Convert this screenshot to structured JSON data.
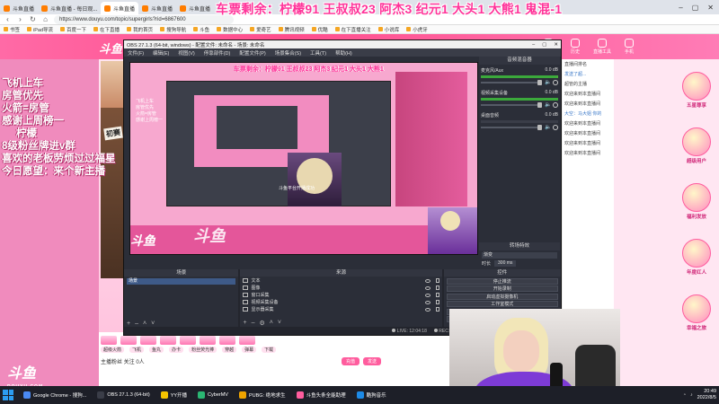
{
  "browser": {
    "tabs": [
      {
        "label": "斗鱼直播",
        "active": false,
        "fav": "orange"
      },
      {
        "label": "斗鱼直播 - 每日观...",
        "active": false,
        "fav": "orange"
      },
      {
        "label": "斗鱼直播",
        "active": true,
        "fav": "orange"
      },
      {
        "label": "斗鱼直播",
        "active": false,
        "fav": "orange"
      },
      {
        "label": "斗鱼直播",
        "active": false,
        "fav": "orange"
      }
    ],
    "url": "https://www.douyu.com/topic/supergirls?rid=6867600",
    "bookmarks": [
      "书签",
      "iPad导流",
      "百度一下",
      "在下直播",
      "我的首页",
      "搜狗导航",
      "斗鱼",
      "数据中心",
      "爱奇艺",
      "腾讯视频",
      "优酷",
      "在下直播关注",
      "小说库",
      "小虎牙"
    ]
  },
  "ticker": "车票剩余：柠檬91 王叔叔23 阿杰3 纪元1 大头1 大熊1 鬼混-1",
  "overlay_lines": [
    "飞机上车",
    "房管优先",
    "火箭=房管",
    "感谢上周榜一",
    "柠檬",
    "8级粉丝牌进v群",
    "喜欢的老板劳烦过过福星",
    "今日愿望：来个新主播"
  ],
  "douyu_logo": "斗鱼",
  "douyu_domain": "DOUYU.COM",
  "header_icons": [
    "关注",
    "历史",
    "直播工具",
    "手机"
  ],
  "obs": {
    "title": "OBS 27.1.3 (64-bit, windows) - 配置文件: 未命名 - 场景: 未命名",
    "menu": [
      "文件(F)",
      "编辑(E)",
      "视图(V)",
      "停靠部件(D)",
      "配置文件(P)",
      "场景集合(S)",
      "工具(T)",
      "帮助(H)"
    ],
    "preview_ticker": "车票剩余：柠檬91 王叔叔23 阿杰3 纪元1 大头1 大熊1",
    "preview_lines": [
      "飞机上车",
      "房管优先",
      "火箭=房管",
      "感谢上周榜一"
    ],
    "preview_notice": "斗鱼平台开播成功",
    "preview_watermark": "斗鱼",
    "mixer_title": "音频混音器",
    "channels": [
      {
        "name": "麦克风/Aux",
        "db": "0.0 dB",
        "level": 0.72,
        "active": true
      },
      {
        "name": "视频采集设备",
        "db": "0.0 dB",
        "level": 0.58,
        "active": true
      },
      {
        "name": "桌面音频",
        "db": "0.0 dB",
        "level": 0.0,
        "active": false
      }
    ],
    "transition_title": "转场特效",
    "transition_value": "渐变",
    "duration_label": "时长",
    "duration_value": "300 ms",
    "scenes_title": "场景",
    "scenes": [
      "场景"
    ],
    "sources_title": "来源",
    "sources": [
      "文本",
      "图像",
      "窗口采集",
      "视频采集设备",
      "显示器采集"
    ],
    "controls_title": "控件",
    "controls": [
      "停止推流",
      "开始录制",
      "启动虚拟摄像机",
      "工作室模式",
      "设置",
      "退出"
    ],
    "status": [
      "LIVE: 12:04:18",
      "REC: 00:00:00",
      "CPU: 9.3%, 60.00 fps",
      "kb/s: 2587"
    ]
  },
  "chat": [
    {
      "text": "直播间排名",
      "blue": false
    },
    {
      "text": "发送了超...",
      "blue": true
    },
    {
      "text": "超管的主播",
      "blue": false
    },
    {
      "text": "欢迎来到本直播间",
      "blue": false
    },
    {
      "text": "欢迎来到本直播间",
      "blue": false
    },
    {
      "text": "大空：马大姐 你的",
      "blue": true
    },
    {
      "text": "欢迎来到本直播间",
      "blue": false
    },
    {
      "text": "欢迎来到本直播间",
      "blue": false
    },
    {
      "text": "欢迎来到本直播间",
      "blue": false
    },
    {
      "text": "欢迎来到本直播间",
      "blue": false
    }
  ],
  "ad_badges": [
    {
      "label": "五星尊享"
    },
    {
      "label": "超级用户"
    },
    {
      "label": "福利发放"
    },
    {
      "label": "年度红人"
    },
    {
      "label": "幸福之旅"
    }
  ],
  "stream_bottom": {
    "gifts": [
      "超级火箭",
      "飞机",
      "鱼丸",
      "办卡",
      "粉丝荧光棒",
      "穿越",
      "弹幕",
      "下载"
    ],
    "follow_text": "主播粉丝 关注 0人",
    "send_label": "发送",
    "recharge_label": "充值"
  },
  "initial_banner": "初赛",
  "taskbar": {
    "items": [
      {
        "label": "Google Chrome - 搜狗...",
        "color": "#4a8af4"
      },
      {
        "label": "OBS 27.1.3 (64-bit)",
        "color": "#3a3d48"
      },
      {
        "label": "YY开播",
        "color": "#f5c400"
      },
      {
        "label": "CyberMV",
        "color": "#2bb673"
      },
      {
        "label": "PUBG: 绝地求生",
        "color": "#f0a500"
      },
      {
        "label": "斗鱼头条全能助理",
        "color": "#ff5d9e"
      },
      {
        "label": "酷狗音乐",
        "color": "#1d8ae6"
      }
    ],
    "time": "20:49",
    "date": "2022/8/5"
  }
}
